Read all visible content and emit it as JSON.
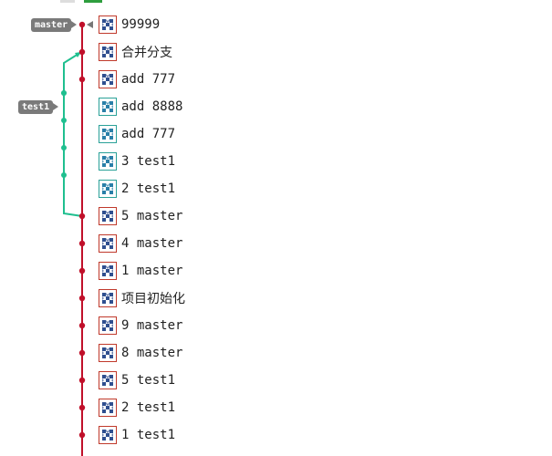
{
  "branch_tags": [
    {
      "label": "master",
      "color": "#7a7a7a"
    },
    {
      "label": "test1",
      "color": "#7a7a7a"
    }
  ],
  "colors": {
    "master_line": "#c0102a",
    "test1_line": "#1fbf8f",
    "strip_green": "#2e9e3e"
  },
  "commits": [
    {
      "message": "99999",
      "branch": "master",
      "avatar_icon": "identicon-icon"
    },
    {
      "message": "合并分支",
      "branch": "master",
      "avatar_icon": "identicon-icon"
    },
    {
      "message": "add 777",
      "branch": "master",
      "avatar_icon": "identicon-icon"
    },
    {
      "message": "add 8888",
      "branch": "test1",
      "avatar_icon": "identicon-icon"
    },
    {
      "message": "add 777",
      "branch": "test1",
      "avatar_icon": "identicon-icon"
    },
    {
      "message": "3 test1",
      "branch": "test1",
      "avatar_icon": "identicon-icon"
    },
    {
      "message": "2 test1",
      "branch": "test1",
      "avatar_icon": "identicon-icon"
    },
    {
      "message": "5 master",
      "branch": "master",
      "avatar_icon": "identicon-icon"
    },
    {
      "message": "4 master",
      "branch": "master",
      "avatar_icon": "identicon-icon"
    },
    {
      "message": "1 master",
      "branch": "master",
      "avatar_icon": "identicon-icon"
    },
    {
      "message": "项目初始化",
      "branch": "master",
      "avatar_icon": "identicon-icon"
    },
    {
      "message": "9 master",
      "branch": "master",
      "avatar_icon": "identicon-icon"
    },
    {
      "message": "8 master",
      "branch": "master",
      "avatar_icon": "identicon-icon"
    },
    {
      "message": "5 test1",
      "branch": "master",
      "avatar_icon": "identicon-icon"
    },
    {
      "message": "2 test1",
      "branch": "master",
      "avatar_icon": "identicon-icon"
    },
    {
      "message": "1 test1",
      "branch": "master",
      "avatar_icon": "identicon-icon"
    }
  ]
}
